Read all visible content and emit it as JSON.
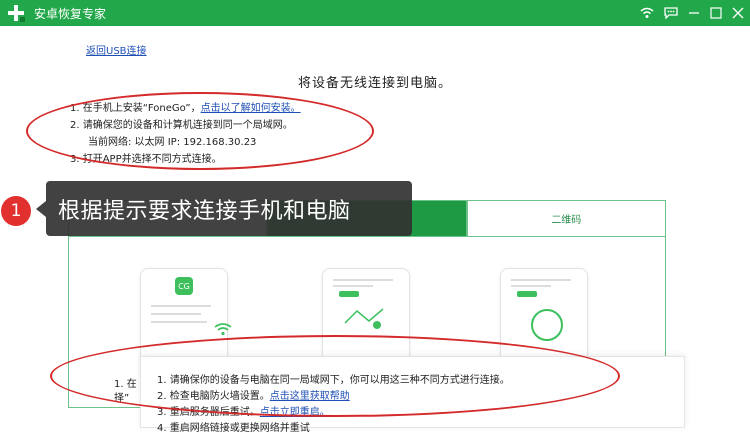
{
  "app": {
    "title": "安卓恢复专家"
  },
  "nav": {
    "back_link": "返回USB连接"
  },
  "page": {
    "heading": "将设备无线连接到电脑。"
  },
  "steps": {
    "s1_prefix": "1. 在手机上安装“FoneGo”，",
    "s1_link": "点击以了解如何安装。",
    "s2": "2. 请确保您的设备和计算机连接到同一个局域网。",
    "s2_network": "当前网络:  以太网    IP:  192.168.30.23",
    "s3": "3. 打开APP并选择不同方式连接。"
  },
  "tabs": [
    {
      "label": ""
    },
    {
      "label": ""
    },
    {
      "label": "二维码"
    }
  ],
  "callout": {
    "number": "1",
    "text": "根据提示要求连接手机和电脑"
  },
  "dialog": {
    "l1": "1. 请确保你的设备与电脑在同一局域网下，你可以用这三种不同方式进行连接。",
    "l2_prefix": "2. 检查电脑防火墙设置。",
    "l2_link": "点击这里获取帮助",
    "l3_prefix": "3. 重启服务器后重试。",
    "l3_link": "点击立即重启。",
    "l4": "4. 重启网络链接或更换网络并重试"
  },
  "left_fragment": {
    "l1": "1. 在",
    "l2": "择”"
  },
  "colors": {
    "title_bar": "#22a84a",
    "accent": "#1e9a45",
    "annotation": "#d42a2a",
    "link": "#1e4fb5"
  },
  "icons": [
    "app-logo-icon",
    "wifi-icon",
    "message-icon",
    "minimize-icon",
    "maximize-icon",
    "close-icon",
    "wireless-signal-icon"
  ]
}
